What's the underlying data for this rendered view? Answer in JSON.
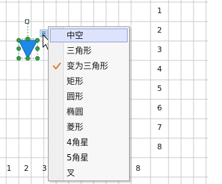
{
  "colors": {
    "grid_line": "#c9c9c9",
    "shape_fill": "#1e88e5",
    "shape_outline": "#1565c0",
    "menu_highlight": "#dde3fb",
    "check_mark": "#e8761e",
    "selection_handle": "#2fa64a"
  },
  "worksheet": {
    "row_numbers": [
      "1",
      "2",
      "3",
      "4",
      "5",
      "6",
      "7",
      "8"
    ],
    "column_numbers": [
      "1",
      "2",
      "3",
      "7",
      "8"
    ]
  },
  "shape": {
    "kind": "triangle",
    "icon": "shape-style-menu-icon",
    "pointer": "mouse-cursor-icon"
  },
  "context_menu": {
    "items": [
      {
        "label": "中空",
        "highlighted": true,
        "checked": false
      },
      {
        "label": "三角形",
        "highlighted": false,
        "checked": false
      },
      {
        "label": "变为三角形",
        "highlighted": false,
        "checked": true
      },
      {
        "label": "矩形",
        "highlighted": false,
        "checked": false
      },
      {
        "label": "圆形",
        "highlighted": false,
        "checked": false
      },
      {
        "label": "椭圆",
        "highlighted": false,
        "checked": false
      },
      {
        "label": "菱形",
        "highlighted": false,
        "checked": false
      },
      {
        "label": "4角星",
        "highlighted": false,
        "checked": false
      },
      {
        "label": "5角星",
        "highlighted": false,
        "checked": false
      },
      {
        "label": "叉",
        "highlighted": false,
        "checked": false
      }
    ]
  }
}
